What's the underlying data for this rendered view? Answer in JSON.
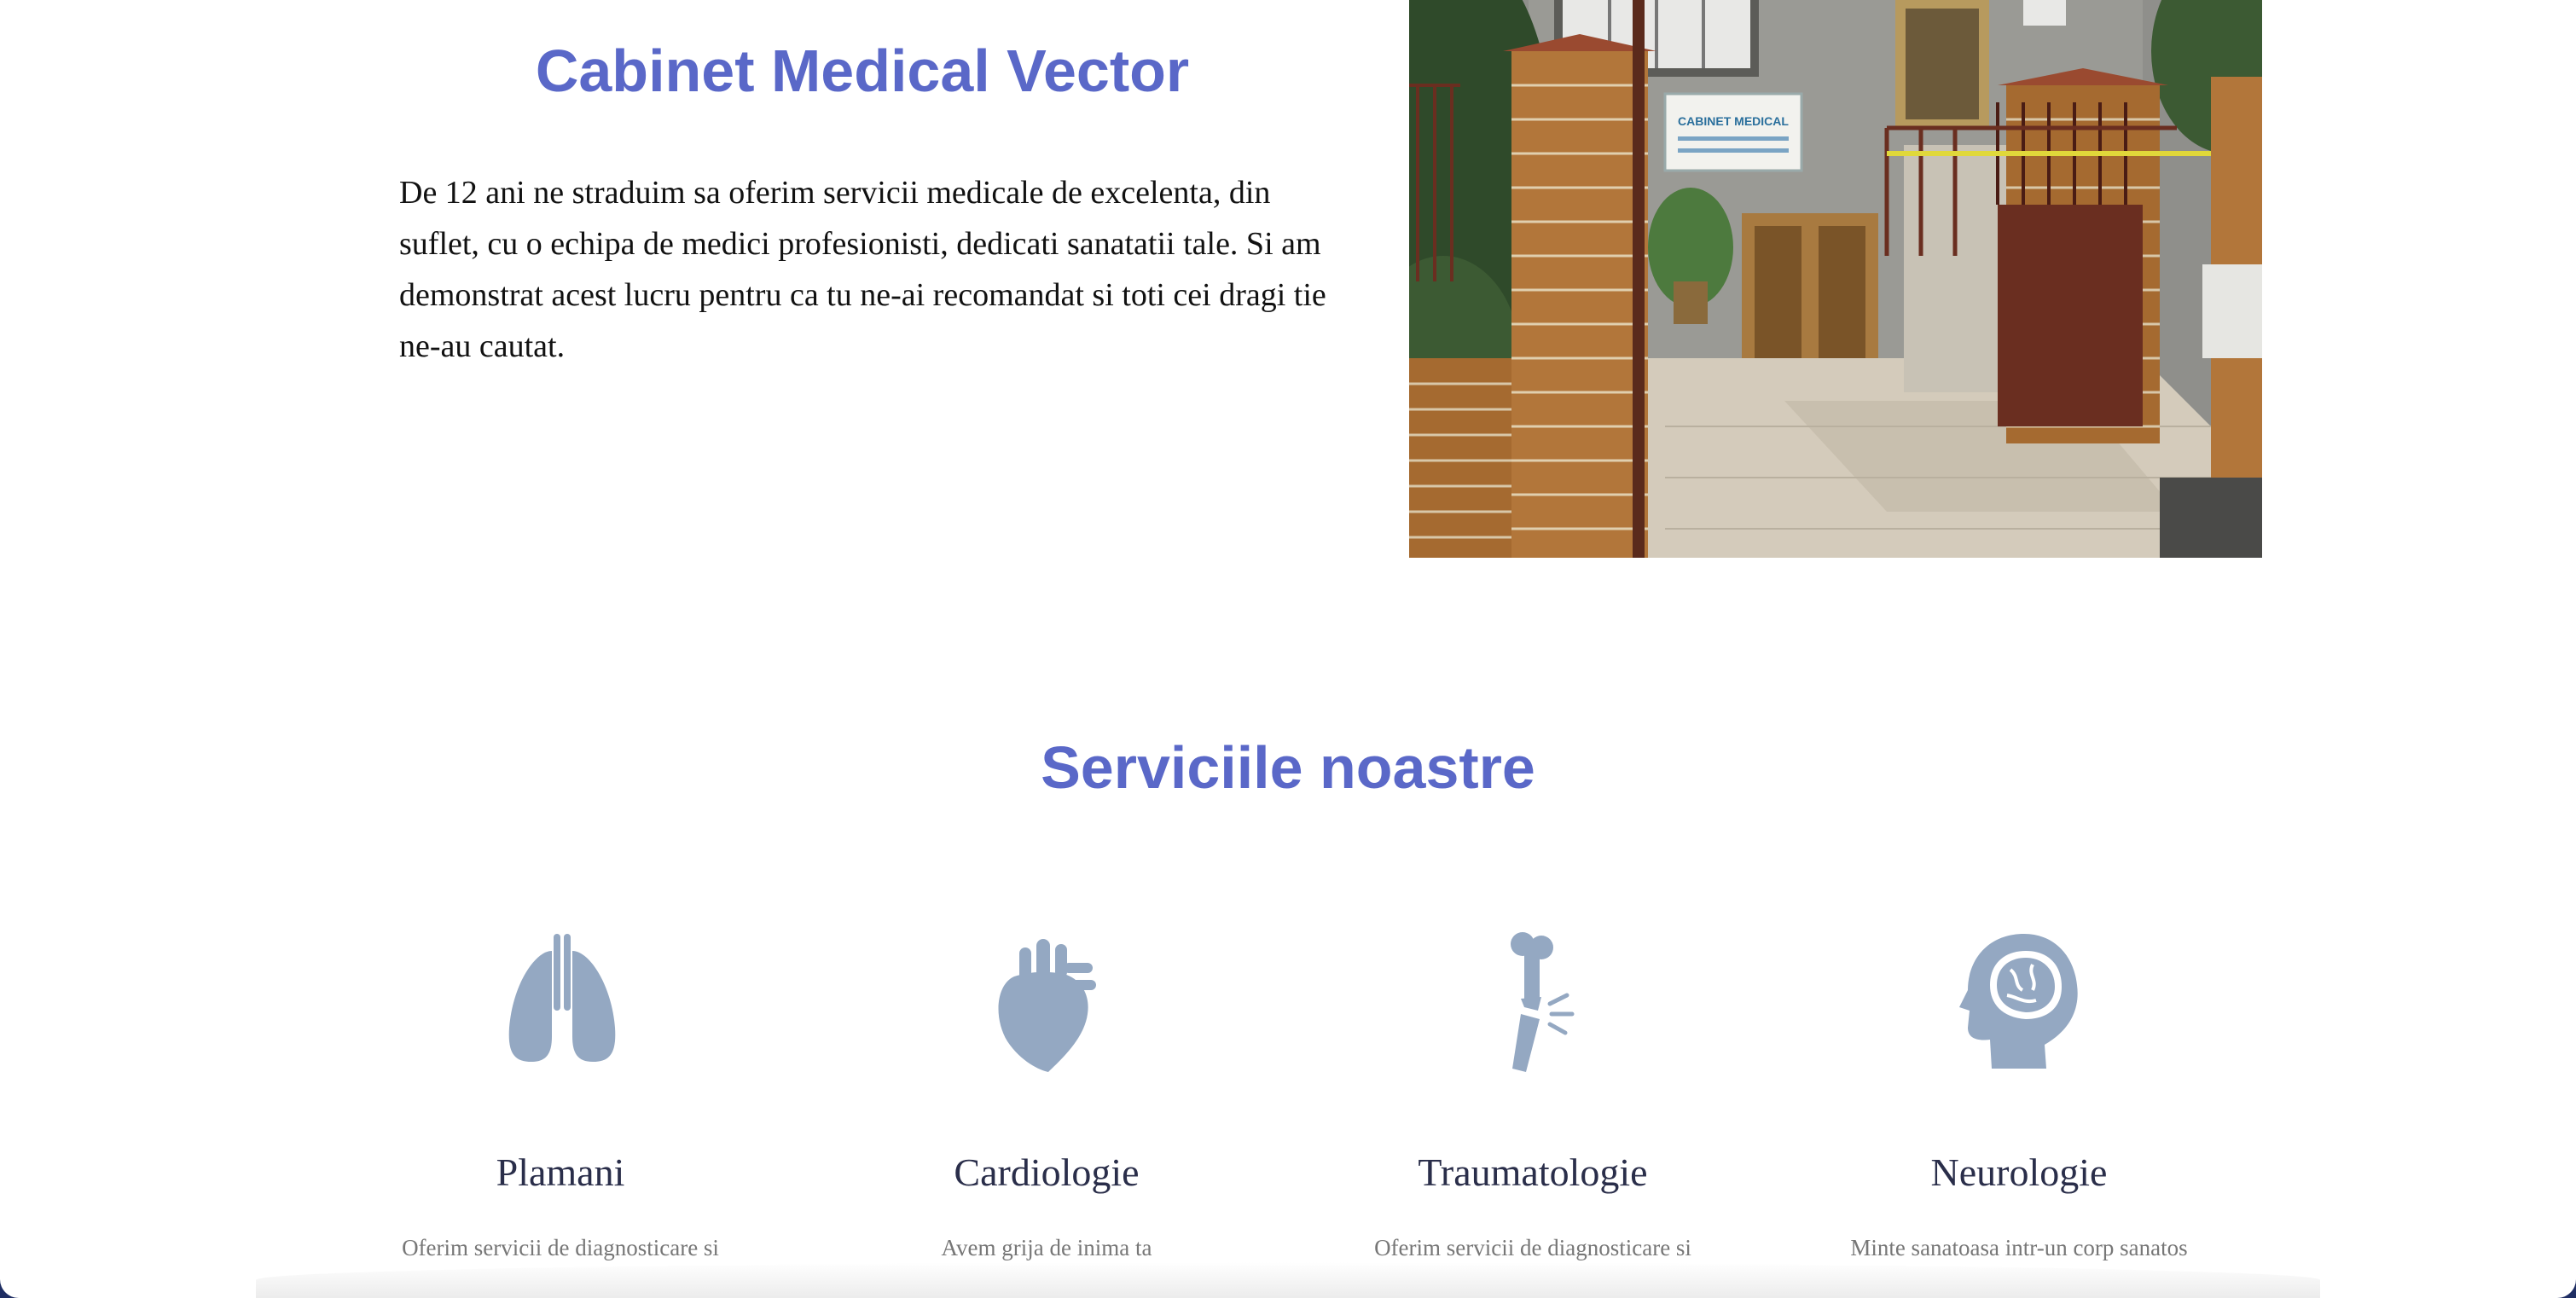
{
  "about": {
    "title": "Cabinet Medical Vector",
    "text": "De 12 ani ne straduim sa oferim servicii medicale de excelenta, din suflet, cu o echipa de medici profesionisti, dedicati sanatatii tale. Si am demonstrat acest lucru pentru ca tu ne-ai recomandat si toti cei dragi tie ne-au cautat.",
    "photo_sign": "CABINET MEDICAL"
  },
  "services": {
    "title": "Serviciile noastre",
    "items": [
      {
        "icon": "lungs-icon",
        "name": "Plamani",
        "desc": "Oferim servicii de diagnosticare si"
      },
      {
        "icon": "heart-icon",
        "name": "Cardiologie",
        "desc": "Avem grija de inima ta"
      },
      {
        "icon": "broken-bone-icon",
        "name": "Traumatologie",
        "desc": "Oferim servicii de diagnosticare si"
      },
      {
        "icon": "brain-head-icon",
        "name": "Neurologie",
        "desc": "Minte sanatoasa intr-un corp sanatos"
      }
    ]
  },
  "colors": {
    "accent": "#5a68c8",
    "icon": "#94a8c2",
    "frame": "#1f2e63"
  }
}
